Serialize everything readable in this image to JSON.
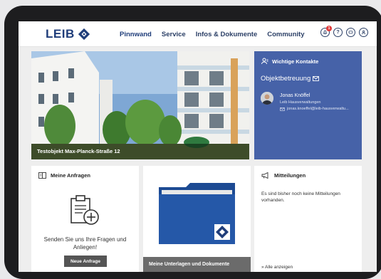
{
  "header": {
    "logo_text": "LEIB",
    "nav": [
      "Pinnwand",
      "Service",
      "Infos & Dokumente",
      "Community"
    ],
    "active_nav": "Pinnwand",
    "notification_count": "1",
    "icons": [
      "bell-icon",
      "help-icon",
      "chat-icon",
      "user-icon"
    ]
  },
  "hero": {
    "caption": "Testobjekt Max-Planck-Straße 12"
  },
  "contacts": {
    "title": "Wichtige Kontakte",
    "subtitle": "Objektbetreuung",
    "person_name": "Jonas Knöffel",
    "person_company": "Leib Hausverwaltungen",
    "person_email": "jonas.knoeffel@leib-hausverwaltu..."
  },
  "requests": {
    "title": "Meine Anfragen",
    "text": "Senden Sie uns Ihre Fragen und Anliegen!",
    "button": "Neue Anfrage"
  },
  "documents": {
    "caption": "Meine Unterlagen und Dokumente"
  },
  "messages": {
    "title": "Mitteilungen",
    "text": "Es sind bisher noch keine Mitteilungen vorhanden.",
    "link": "» Alle anzeigen"
  },
  "colors": {
    "brand": "#1f3d7a",
    "contacts_bg": "#4662a8",
    "folder": "#1f4f99"
  }
}
